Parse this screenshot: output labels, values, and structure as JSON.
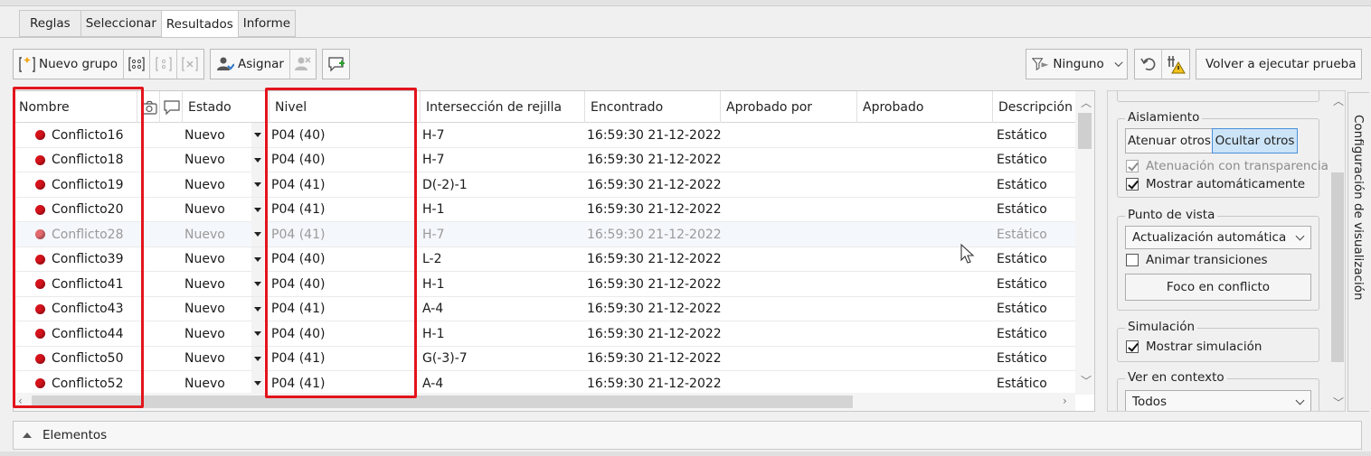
{
  "tabs": [
    {
      "label": "Reglas",
      "active": false
    },
    {
      "label": "Seleccionar",
      "active": false
    },
    {
      "label": "Resultados",
      "active": true
    },
    {
      "label": "Informe",
      "active": false
    }
  ],
  "toolbar": {
    "new_group_label": "Nuevo grupo",
    "assign_label": "Asignar",
    "filter_label": "Ninguno",
    "rerun_label": "Volver a ejecutar prueba"
  },
  "table": {
    "columns": {
      "nombre": "Nombre",
      "estado": "Estado",
      "nivel": "Nivel",
      "interseccion": "Intersección de rejilla",
      "encontrado": "Encontrado",
      "aprobado_por": "Aprobado por",
      "aprobado": "Aprobado",
      "descripcion": "Descripción"
    },
    "rows": [
      {
        "nombre": "Conflicto16",
        "estado": "Nuevo",
        "nivel": "P04 (40)",
        "rejilla": "H-7",
        "encontrado": "16:59:30 21-12-2022",
        "descripcion": "Estático"
      },
      {
        "nombre": "Conflicto18",
        "estado": "Nuevo",
        "nivel": "P04 (40)",
        "rejilla": "H-7",
        "encontrado": "16:59:30 21-12-2022",
        "descripcion": "Estático"
      },
      {
        "nombre": "Conflicto19",
        "estado": "Nuevo",
        "nivel": "P04 (41)",
        "rejilla": "D(-2)-1",
        "encontrado": "16:59:30 21-12-2022",
        "descripcion": "Estático"
      },
      {
        "nombre": "Conflicto20",
        "estado": "Nuevo",
        "nivel": "P04 (41)",
        "rejilla": "H-1",
        "encontrado": "16:59:30 21-12-2022",
        "descripcion": "Estático"
      },
      {
        "nombre": "Conflicto28",
        "estado": "Nuevo",
        "nivel": "P04 (41)",
        "rejilla": "H-7",
        "encontrado": "16:59:30 21-12-2022",
        "descripcion": "Estático"
      },
      {
        "nombre": "Conflicto39",
        "estado": "Nuevo",
        "nivel": "P04 (40)",
        "rejilla": "L-2",
        "encontrado": "16:59:30 21-12-2022",
        "descripcion": "Estático"
      },
      {
        "nombre": "Conflicto41",
        "estado": "Nuevo",
        "nivel": "P04 (40)",
        "rejilla": "H-1",
        "encontrado": "16:59:30 21-12-2022",
        "descripcion": "Estático"
      },
      {
        "nombre": "Conflicto43",
        "estado": "Nuevo",
        "nivel": "P04 (41)",
        "rejilla": "A-4",
        "encontrado": "16:59:30 21-12-2022",
        "descripcion": "Estático"
      },
      {
        "nombre": "Conflicto44",
        "estado": "Nuevo",
        "nivel": "P04 (40)",
        "rejilla": "H-1",
        "encontrado": "16:59:30 21-12-2022",
        "descripcion": "Estático"
      },
      {
        "nombre": "Conflicto50",
        "estado": "Nuevo",
        "nivel": "P04 (41)",
        "rejilla": "G(-3)-7",
        "encontrado": "16:59:30 21-12-2022",
        "descripcion": "Estático"
      },
      {
        "nombre": "Conflicto52",
        "estado": "Nuevo",
        "nivel": "P04 (41)",
        "rejilla": "A-4",
        "encontrado": "16:59:30 21-12-2022",
        "descripcion": "Estático"
      }
    ]
  },
  "right_panel": {
    "aislamiento": {
      "title": "Aislamiento",
      "btn_dim": "Atenuar otros",
      "btn_hide": "Ocultar otros",
      "chk_transparency": "Atenuación con transparencia",
      "chk_auto": "Mostrar automáticamente"
    },
    "punto_de_vista": {
      "title": "Punto de vista",
      "select_value": "Actualización automática",
      "chk_animate": "Animar transiciones",
      "btn_focus": "Foco en conflicto"
    },
    "simulacion": {
      "title": "Simulación",
      "chk_show": "Mostrar simulación"
    },
    "contexto": {
      "title": "Ver en contexto",
      "select_value": "Todos"
    }
  },
  "side_tab_label": "Configuración de visualización",
  "bottom_bar_label": "Elementos",
  "colors": {
    "conflict_dot": "#d5121b",
    "highlight": "#e3141c",
    "accent": "#cce4f7"
  }
}
